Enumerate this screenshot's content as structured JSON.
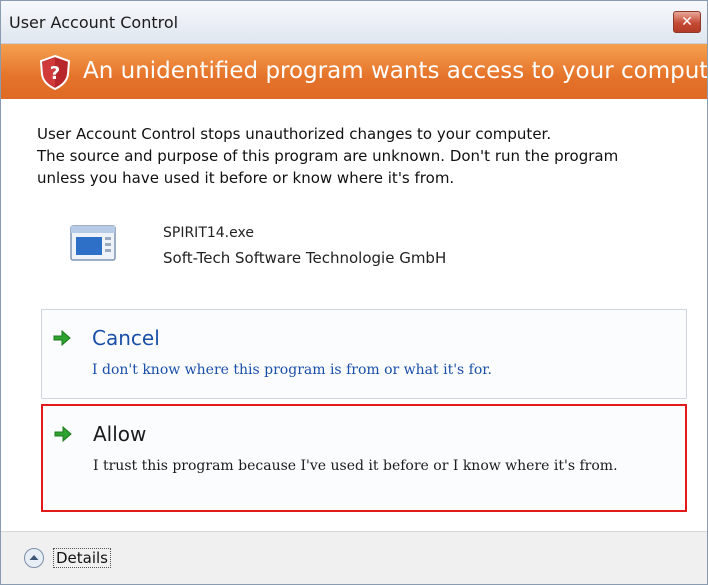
{
  "window": {
    "title": "User Account Control",
    "close_glyph": "✕"
  },
  "banner": {
    "icon": "shield-question-icon",
    "text": "An unidentified program wants access to your computer",
    "color": "#e5732a"
  },
  "message": {
    "line1": "User Account Control stops unauthorized changes to your computer.",
    "line2": "The source and purpose of this program are unknown.  Don't run the program",
    "line3": "unless you have used it before or know where it's from."
  },
  "program": {
    "icon": "program-window-icon",
    "name": "SPIRIT14.exe",
    "publisher": "Soft-Tech Software Technologie GmbH"
  },
  "options": {
    "cancel": {
      "icon": "green-arrow-icon",
      "title": "Cancel",
      "description": "I don't know where this program is from or what it's for."
    },
    "allow": {
      "icon": "green-arrow-icon",
      "title": "Allow",
      "description": "I trust this program because I've used it before or I know where it's from.",
      "highlight_color": "#e21a1a"
    }
  },
  "footer": {
    "details_icon": "chevron-up-circle-icon",
    "details_label": "Details"
  }
}
